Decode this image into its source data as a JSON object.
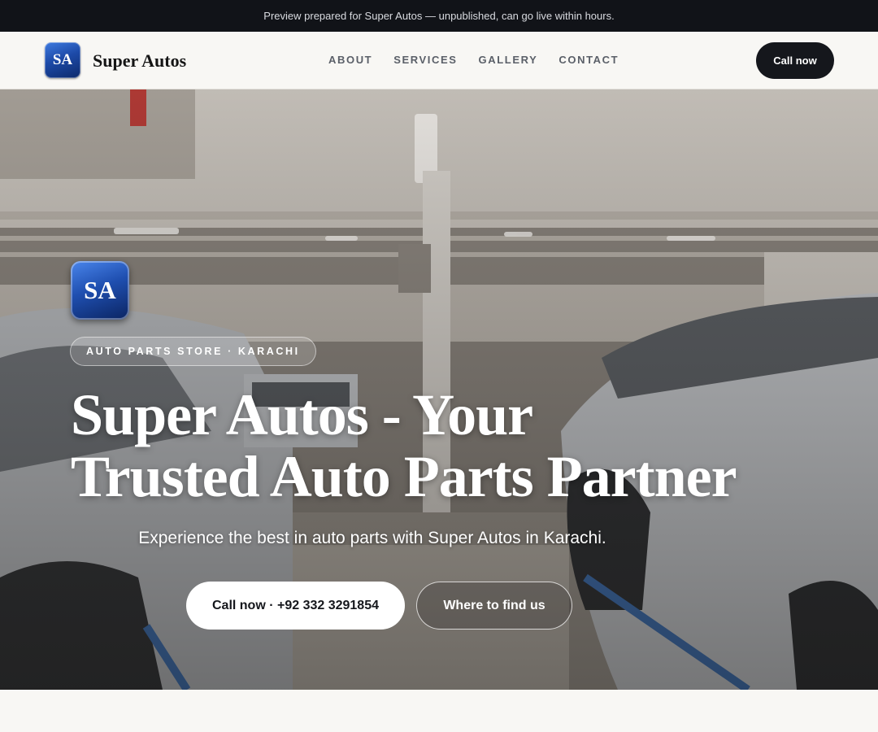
{
  "preview_bar": {
    "text": "Preview prepared for Super Autos — unpublished, can go live within hours."
  },
  "header": {
    "logo_initials": "SA",
    "brand_name": "Super Autos",
    "nav": [
      "ABOUT",
      "SERVICES",
      "GALLERY",
      "CONTACT"
    ],
    "call_button": "Call now"
  },
  "hero": {
    "background_icon": "garage-workshop-photo",
    "logo_initials": "SA",
    "tag": "AUTO PARTS STORE · KARACHI",
    "title_line1": "Super Autos - Your",
    "title_line2": "Trusted Auto Parts Partner",
    "subtitle": "Experience the best in auto parts with Super Autos in Karachi.",
    "primary_button": "Call now · +92 332 3291854",
    "secondary_button": "Where to find us"
  },
  "colors": {
    "dark": "#15171c",
    "brand_blue": "#1d4aa8",
    "background": "#f8f7f4"
  }
}
